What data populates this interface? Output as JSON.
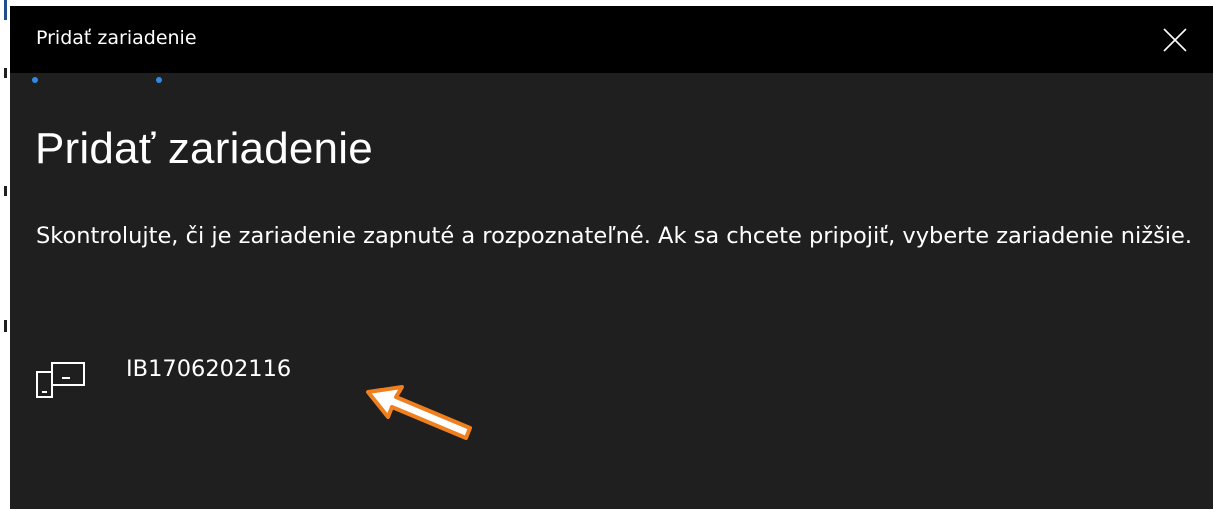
{
  "window": {
    "title": "Pridať zariadenie",
    "close_icon": "close-icon"
  },
  "wizard": {
    "step_count": 2
  },
  "main": {
    "heading": "Pridať zariadenie",
    "description": "Skontrolujte, či je zariadenie zapnuté a rozpoznateľné. Ak sa chcete pripojiť, vyberte zariadenie nižšie."
  },
  "devices": [
    {
      "name": "IB1706202116",
      "icon": "devices-icon"
    }
  ],
  "annotation": {
    "icon": "arrow-annotation",
    "color": "#f07f1d"
  },
  "colors": {
    "titlebar_bg": "#000000",
    "dialog_bg": "#1f1f1f",
    "text": "#ffffff",
    "accent": "#2f8ae6"
  }
}
